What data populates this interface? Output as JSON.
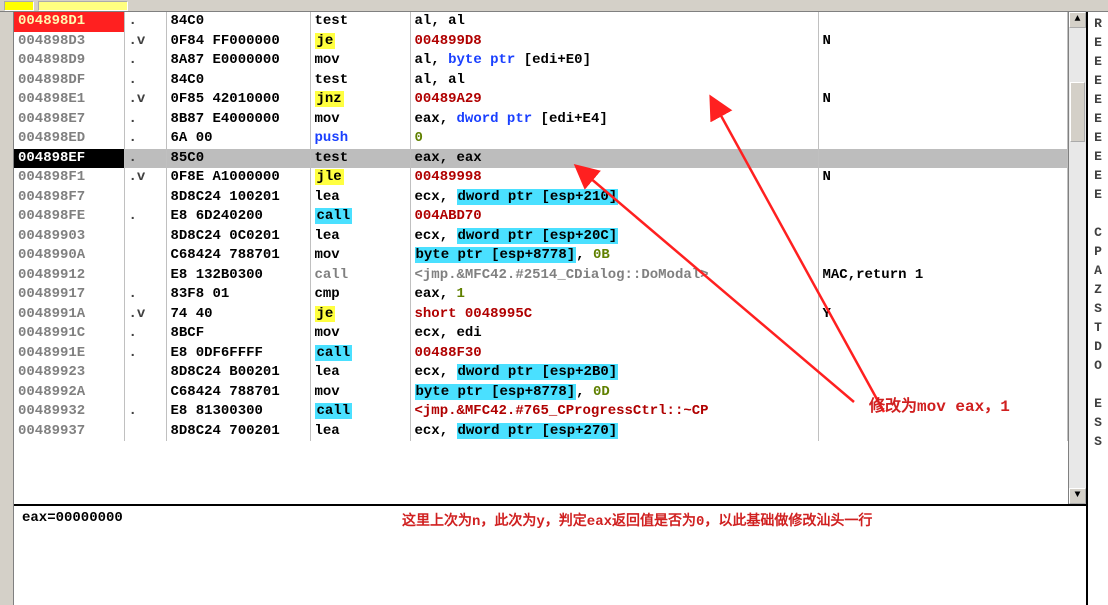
{
  "rows": [
    {
      "addr": "004898D1",
      "dir": ".",
      "hex": "84C0",
      "mnKind": "plain",
      "mn": "test",
      "ops": [
        {
          "t": "black",
          "v": "al"
        },
        {
          "t": "black",
          "v": ", "
        },
        {
          "t": "black",
          "v": "al"
        }
      ],
      "cmt": "",
      "addrStyle": "red"
    },
    {
      "addr": "004898D3",
      "dir": ".v",
      "hex": "0F84 FF000000",
      "mnKind": "jmp",
      "mn": "je",
      "ops": [
        {
          "t": "red",
          "v": "004899D8"
        }
      ],
      "cmt": "N"
    },
    {
      "addr": "004898D9",
      "dir": ".",
      "hex": "8A87 E0000000",
      "mnKind": "plain",
      "mn": "mov",
      "ops": [
        {
          "t": "black",
          "v": "al, "
        },
        {
          "t": "blue",
          "v": "byte ptr"
        },
        {
          "t": "black",
          "v": " ["
        },
        {
          "t": "black",
          "v": "edi+E0"
        },
        {
          "t": "black",
          "v": "]"
        }
      ],
      "cmt": ""
    },
    {
      "addr": "004898DF",
      "dir": ".",
      "hex": "84C0",
      "mnKind": "plain",
      "mn": "test",
      "ops": [
        {
          "t": "black",
          "v": "al, al"
        }
      ],
      "cmt": ""
    },
    {
      "addr": "004898E1",
      "dir": ".v",
      "hex": "0F85 42010000",
      "mnKind": "jmp",
      "mn": "jnz",
      "ops": [
        {
          "t": "red",
          "v": "00489A29"
        }
      ],
      "cmt": "N"
    },
    {
      "addr": "004898E7",
      "dir": ".",
      "hex": "8B87 E4000000",
      "mnKind": "plain",
      "mn": "mov",
      "ops": [
        {
          "t": "black",
          "v": "eax, "
        },
        {
          "t": "blue",
          "v": "dword ptr"
        },
        {
          "t": "black",
          "v": " [edi+E4]"
        }
      ],
      "cmt": ""
    },
    {
      "addr": "004898ED",
      "dir": ".",
      "hex": "6A 00",
      "mnKind": "blue",
      "mn": "push",
      "ops": [
        {
          "t": "num",
          "v": "0"
        }
      ],
      "cmt": ""
    },
    {
      "addr": "004898EF",
      "dir": ".",
      "hex": "85C0",
      "mnKind": "plain",
      "mn": "test",
      "ops": [
        {
          "t": "black",
          "v": "eax, eax"
        }
      ],
      "cmt": "",
      "sel": true,
      "addrStyle": "black"
    },
    {
      "addr": "004898F1",
      "dir": ".v",
      "hex": "0F8E A1000000",
      "mnKind": "jmp",
      "mn": "jle",
      "ops": [
        {
          "t": "red",
          "v": "00489998"
        }
      ],
      "cmt": "N"
    },
    {
      "addr": "004898F7",
      "dir": "",
      "hex": "8D8C24 100201",
      "mnKind": "plain",
      "mn": "lea",
      "ops": [
        {
          "t": "black",
          "v": "ecx, "
        },
        {
          "t": "hl",
          "v": "dword ptr [esp+210]"
        }
      ],
      "cmt": ""
    },
    {
      "addr": "004898FE",
      "dir": ".",
      "hex": "E8 6D240200",
      "mnKind": "call",
      "mn": "call",
      "ops": [
        {
          "t": "red",
          "v": "004ABD70"
        }
      ],
      "cmt": ""
    },
    {
      "addr": "00489903",
      "dir": "",
      "hex": "8D8C24 0C0201",
      "mnKind": "plain",
      "mn": "lea",
      "ops": [
        {
          "t": "black",
          "v": "ecx, "
        },
        {
          "t": "hl",
          "v": "dword ptr [esp+20C]"
        }
      ],
      "cmt": ""
    },
    {
      "addr": "0048990A",
      "dir": "",
      "hex": "C68424 788701",
      "mnKind": "plain",
      "mn": "mov",
      "ops": [
        {
          "t": "hl",
          "v": "byte ptr [esp+8778]"
        },
        {
          "t": "black",
          "v": ", "
        },
        {
          "t": "num",
          "v": "0B"
        }
      ],
      "cmt": ""
    },
    {
      "addr": "00489912",
      "dir": "",
      "hex": "E8 132B0300",
      "mnKind": "gray",
      "mn": "call",
      "ops": [
        {
          "t": "gray",
          "v": "<jmp.&MFC42.#2514_CDialog::DoModal>"
        }
      ],
      "cmt": "MAC,return 1"
    },
    {
      "addr": "00489917",
      "dir": ".",
      "hex": "83F8 01",
      "mnKind": "plain",
      "mn": "cmp",
      "ops": [
        {
          "t": "black",
          "v": "eax, "
        },
        {
          "t": "num",
          "v": "1"
        }
      ],
      "cmt": ""
    },
    {
      "addr": "0048991A",
      "dir": ".v",
      "hex": "74 40",
      "mnKind": "jmp",
      "mn": "je",
      "ops": [
        {
          "t": "red",
          "v": "short 0048995C"
        }
      ],
      "cmt": "Y"
    },
    {
      "addr": "0048991C",
      "dir": ".",
      "hex": "8BCF",
      "mnKind": "plain",
      "mn": "mov",
      "ops": [
        {
          "t": "black",
          "v": "ecx, edi"
        }
      ],
      "cmt": ""
    },
    {
      "addr": "0048991E",
      "dir": ".",
      "hex": "E8 0DF6FFFF",
      "mnKind": "call",
      "mn": "call",
      "ops": [
        {
          "t": "red",
          "v": "00488F30"
        }
      ],
      "cmt": ""
    },
    {
      "addr": "00489923",
      "dir": "",
      "hex": "8D8C24 B00201",
      "mnKind": "plain",
      "mn": "lea",
      "ops": [
        {
          "t": "black",
          "v": "ecx, "
        },
        {
          "t": "hl",
          "v": "dword ptr [esp+2B0]"
        }
      ],
      "cmt": ""
    },
    {
      "addr": "0048992A",
      "dir": "",
      "hex": "C68424 788701",
      "mnKind": "plain",
      "mn": "mov",
      "ops": [
        {
          "t": "hl",
          "v": "byte ptr [esp+8778]"
        },
        {
          "t": "black",
          "v": ", "
        },
        {
          "t": "num",
          "v": "0D"
        }
      ],
      "cmt": ""
    },
    {
      "addr": "00489932",
      "dir": ".",
      "hex": "E8 81300300",
      "mnKind": "call",
      "mn": "call",
      "ops": [
        {
          "t": "red",
          "v": "<jmp.&MFC42.#765_CProgressCtrl::~CP"
        }
      ],
      "cmt": ""
    },
    {
      "addr": "00489937",
      "dir": "",
      "hex": "8D8C24 700201",
      "mnKind": "plain",
      "mn": "lea",
      "ops": [
        {
          "t": "black",
          "v": "ecx, "
        },
        {
          "t": "hl",
          "v": "dword ptr [esp+270]"
        }
      ],
      "cmt": ""
    }
  ],
  "annotation_right": "修改为mov eax，1",
  "bottom_eax": "eax=00000000",
  "bottom_cn": "这里上次为n，此次为y，判定eax返回值是否为0，以此基础做修改汕头一行",
  "side_regs": [
    "R",
    "E",
    "E",
    "E",
    "E",
    "E",
    "E",
    "E",
    "E",
    "E",
    "",
    "C",
    "P",
    "A",
    "Z",
    "S",
    "T",
    "D",
    "O",
    "",
    "E",
    "S",
    "S"
  ]
}
